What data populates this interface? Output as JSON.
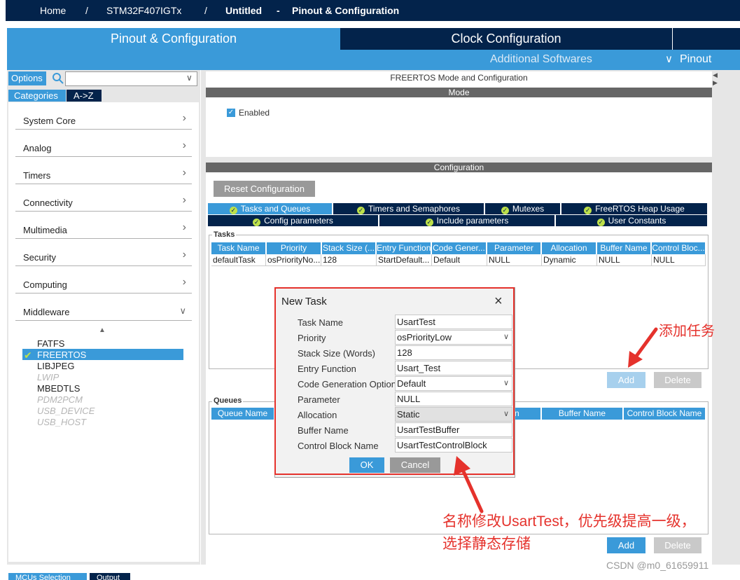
{
  "breadcrumb": {
    "home": "Home",
    "sep": "/",
    "mcu": "STM32F407IGTx",
    "project": "Untitled",
    "dash": "-",
    "page": "Pinout & Configuration"
  },
  "main_tabs": {
    "pinout": "Pinout & Configuration",
    "clock": "Clock Configuration"
  },
  "subbar": {
    "additional": "Additional Softwares",
    "pinout_menu": "Pinout"
  },
  "left": {
    "options_tab": "Options",
    "categories_tab": "Categories",
    "az_tab": "A->Z",
    "search_value": "",
    "categories": [
      "System Core",
      "Analog",
      "Timers",
      "Connectivity",
      "Multimedia",
      "Security",
      "Computing",
      "Middleware"
    ],
    "middleware": [
      {
        "label": "FATFS",
        "state": "normal"
      },
      {
        "label": "FREERTOS",
        "state": "selected"
      },
      {
        "label": "LIBJPEG",
        "state": "normal"
      },
      {
        "label": "LWIP",
        "state": "disabled"
      },
      {
        "label": "MBEDTLS",
        "state": "normal"
      },
      {
        "label": "PDM2PCM",
        "state": "disabled"
      },
      {
        "label": "USB_DEVICE",
        "state": "disabled"
      },
      {
        "label": "USB_HOST",
        "state": "disabled"
      }
    ]
  },
  "right": {
    "title": "FREERTOS Mode and Configuration",
    "mode_header": "Mode",
    "enabled_label": "Enabled",
    "config_header": "Configuration",
    "reset_button": "Reset Configuration",
    "config_tabs_row1": [
      "Tasks and Queues",
      "Timers and Semaphores",
      "Mutexes",
      "FreeRTOS Heap Usage"
    ],
    "config_tabs_row2": [
      "Config parameters",
      "Include parameters",
      "User Constants"
    ],
    "tasks_legend": "Tasks",
    "task_columns": [
      "Task Name",
      "Priority",
      "Stack Size (...",
      "Entry Function",
      "Code Gener...",
      "Parameter",
      "Allocation",
      "Buffer Name",
      "Control Bloc..."
    ],
    "task_rows": [
      [
        "defaultTask",
        "osPriorityNo...",
        "128",
        "StartDefault...",
        "Default",
        "NULL",
        "Dynamic",
        "NULL",
        "NULL"
      ]
    ],
    "add_button": "Add",
    "delete_button": "Delete",
    "queues_legend": "Queues",
    "queue_columns_visible": [
      "Queue Name",
      "n",
      "Buffer Name",
      "Control Block Name"
    ],
    "bottom_tabs": [
      "MCUs Selection",
      "Output"
    ]
  },
  "dialog": {
    "title": "New Task",
    "labels": [
      "Task Name",
      "Priority",
      "Stack Size (Words)",
      "Entry Function",
      "Code Generation Option",
      "Parameter",
      "Allocation",
      "Buffer Name",
      "Control Block Name"
    ],
    "values": [
      "UsartTest",
      "osPriorityLow",
      "128",
      "Usart_Test",
      "Default",
      "NULL",
      "Static",
      "UsartTestBuffer",
      "UsartTestControlBlock"
    ],
    "ok": "OK",
    "cancel": "Cancel"
  },
  "annotations": {
    "add_task": "添加任务",
    "note_line1": "名称修改UsartTest，优先级提高一级，",
    "note_line2": "选择静态存储",
    "annotation_color": "#e5322c"
  },
  "watermark": "CSDN @m0_61659911",
  "colors": {
    "navy": "#03234b",
    "accent": "#3a9ad9",
    "panel": "#e6e6e6"
  }
}
